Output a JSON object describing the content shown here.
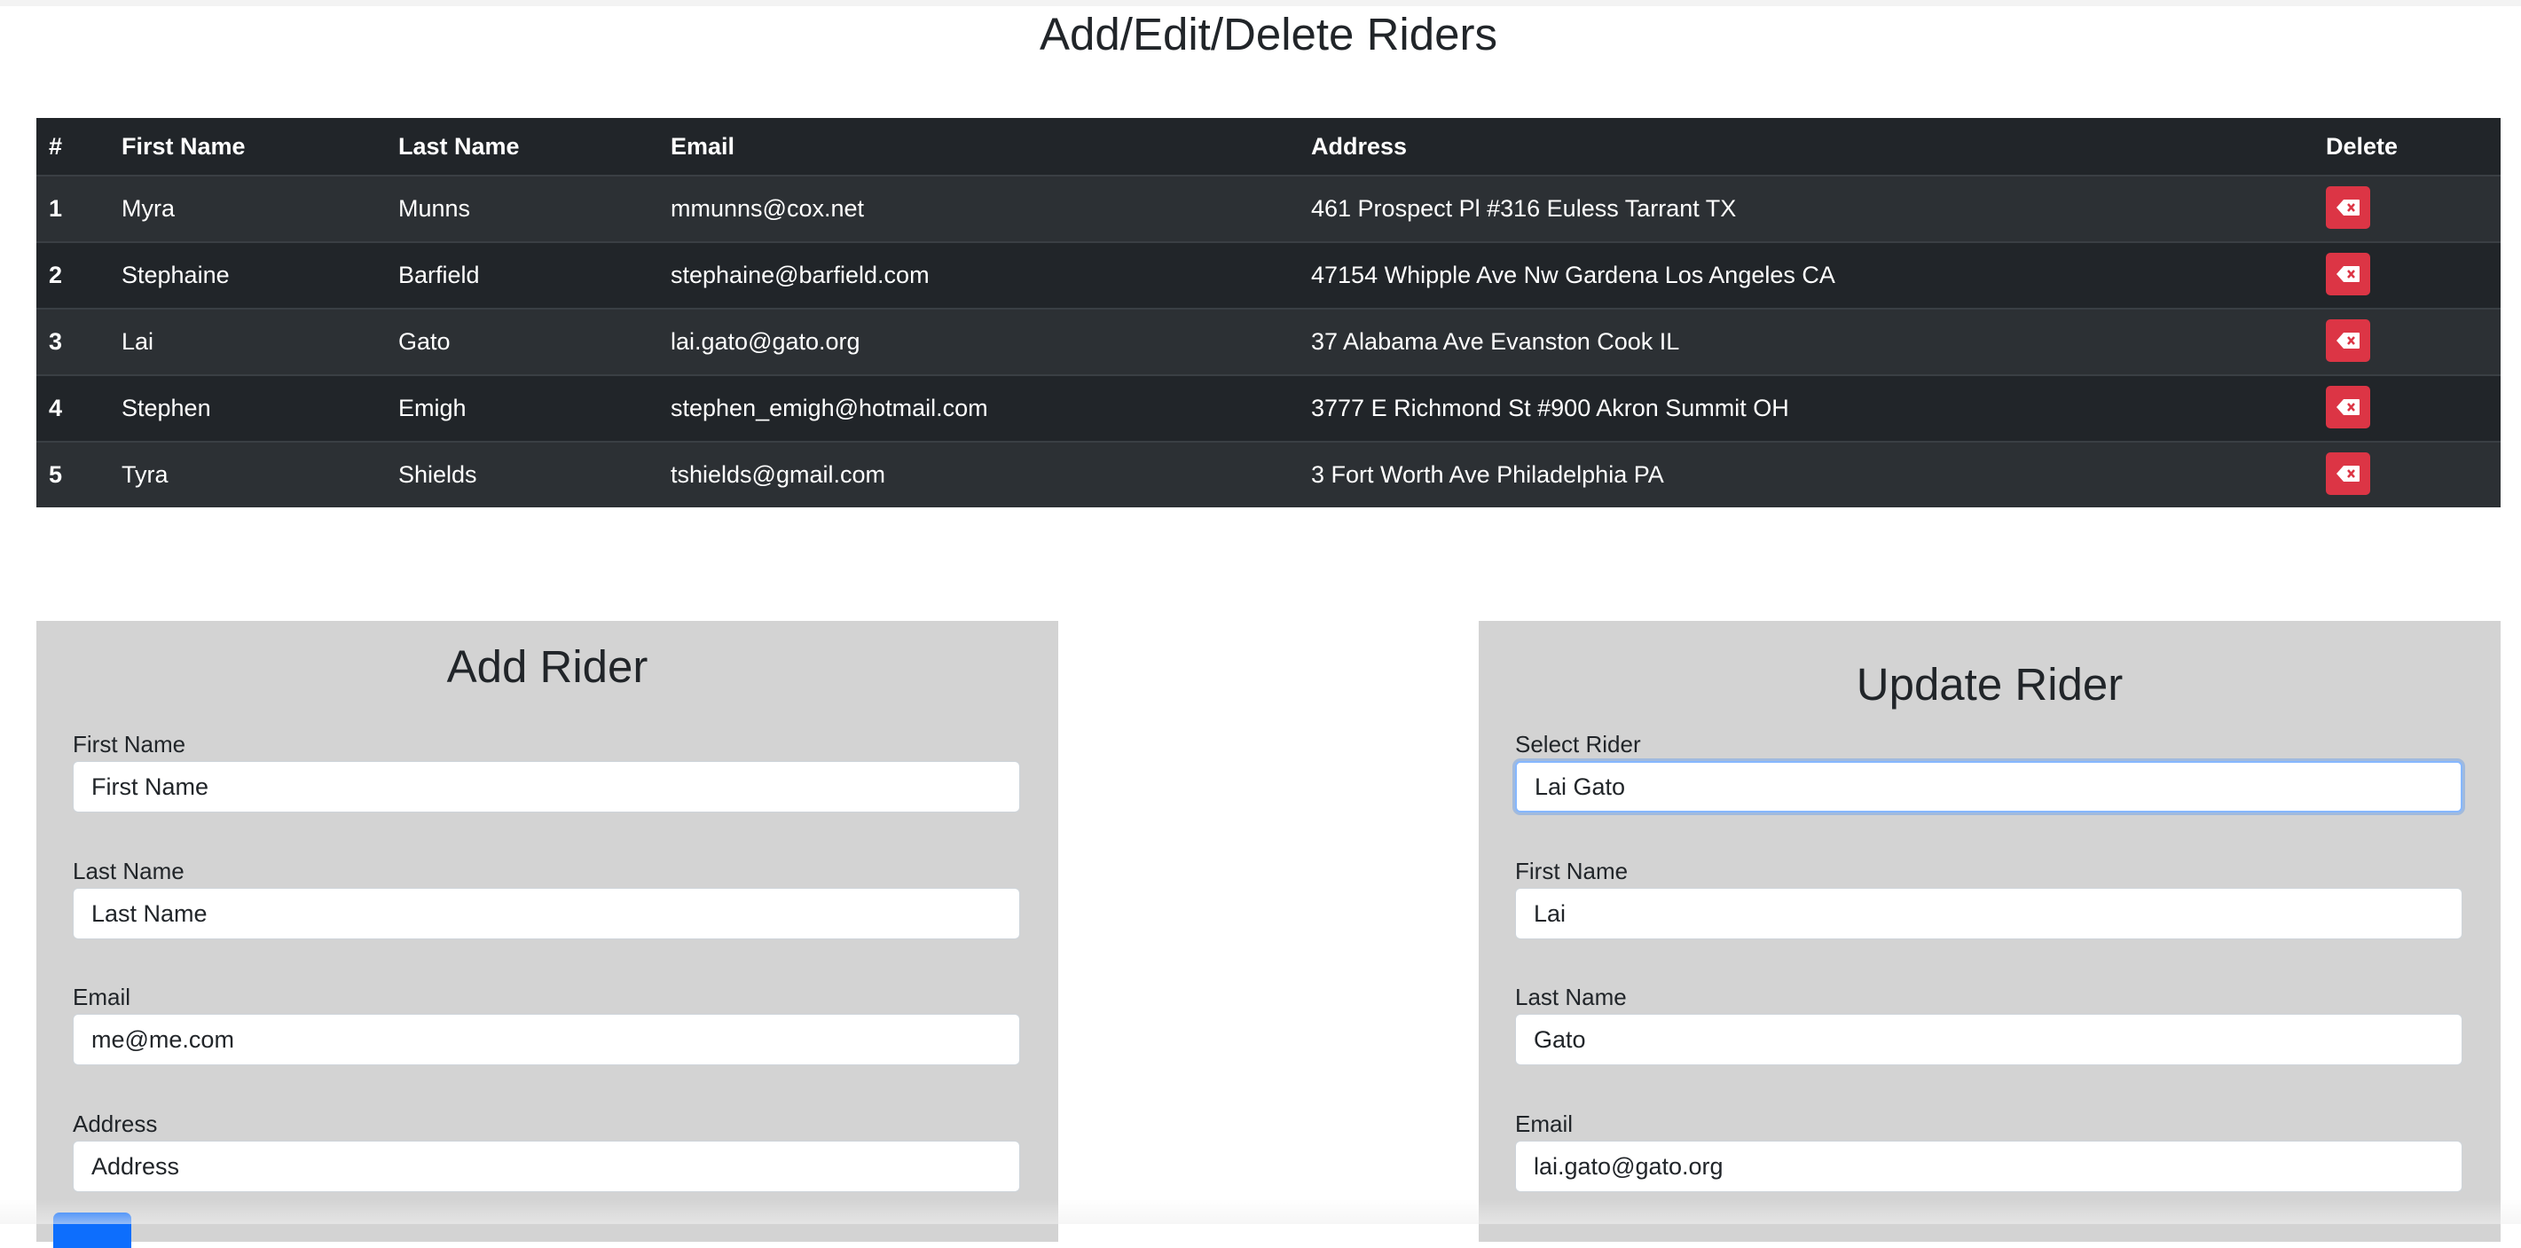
{
  "page": {
    "title": "Add/Edit/Delete Riders"
  },
  "table": {
    "headers": [
      "#",
      "First Name",
      "Last Name",
      "Email",
      "Address",
      "Delete"
    ],
    "rows": [
      {
        "num": "1",
        "first": "Myra",
        "last": "Munns",
        "email": "mmunns@cox.net",
        "address": "461 Prospect Pl #316 Euless Tarrant TX"
      },
      {
        "num": "2",
        "first": "Stephaine",
        "last": "Barfield",
        "email": "stephaine@barfield.com",
        "address": "47154 Whipple Ave Nw Gardena Los Angeles CA"
      },
      {
        "num": "3",
        "first": "Lai",
        "last": "Gato",
        "email": "lai.gato@gato.org",
        "address": "37 Alabama Ave Evanston Cook IL"
      },
      {
        "num": "4",
        "first": "Stephen",
        "last": "Emigh",
        "email": "stephen_emigh@hotmail.com",
        "address": "3777 E Richmond St #900 Akron Summit OH"
      },
      {
        "num": "5",
        "first": "Tyra",
        "last": "Shields",
        "email": "tshields@gmail.com",
        "address": "3 Fort Worth Ave Philadelphia PA"
      }
    ],
    "delete_icon": "backspace-x-icon"
  },
  "add_form": {
    "title": "Add Rider",
    "first_name": {
      "label": "First Name",
      "placeholder": "First Name",
      "value": ""
    },
    "last_name": {
      "label": "Last Name",
      "placeholder": "Last Name",
      "value": ""
    },
    "email": {
      "label": "Email",
      "placeholder": "me@me.com",
      "value": ""
    },
    "address": {
      "label": "Address",
      "placeholder": "Address",
      "value": ""
    }
  },
  "update_form": {
    "title": "Update Rider",
    "select_rider": {
      "label": "Select Rider",
      "value": "Lai Gato"
    },
    "first_name": {
      "label": "First Name",
      "value": "Lai"
    },
    "last_name": {
      "label": "Last Name",
      "value": "Gato"
    },
    "email": {
      "label": "Email",
      "value": "lai.gato@gato.org"
    }
  },
  "colors": {
    "table_dark": "#212529",
    "table_striped": "#2c3034",
    "danger": "#dc3545",
    "panel_bg": "#d3d3d3",
    "primary": "#0d6efd",
    "focus": "#86b7fe"
  }
}
